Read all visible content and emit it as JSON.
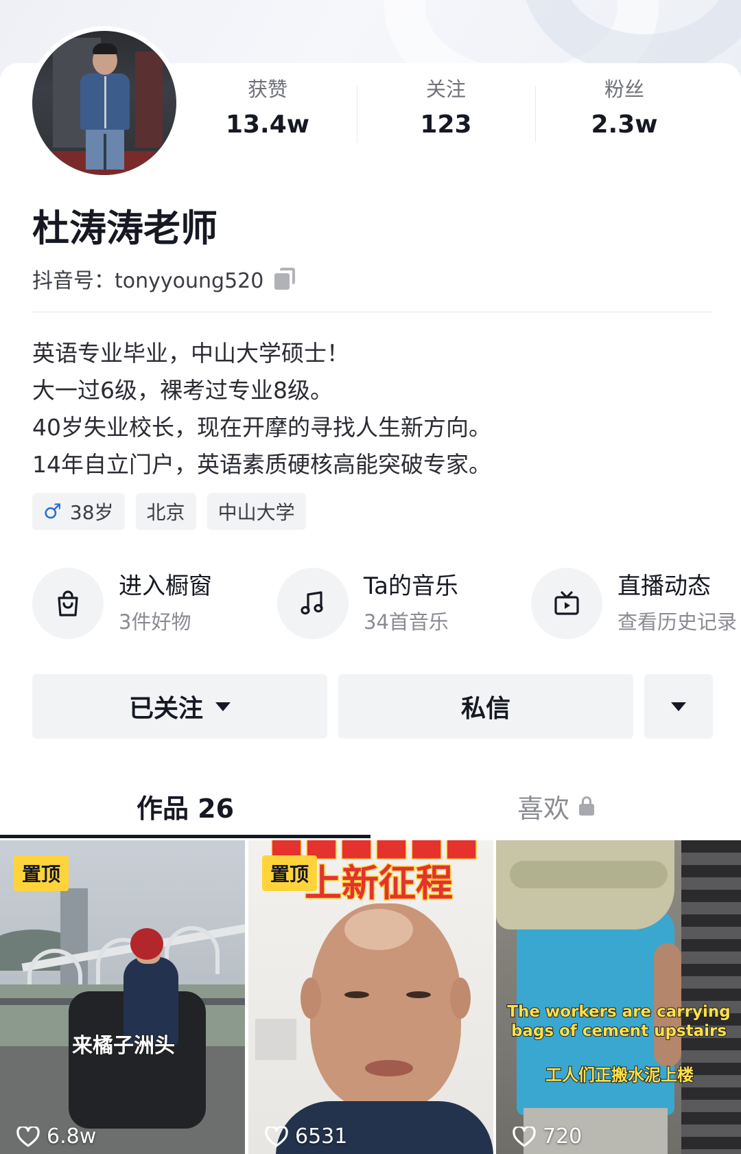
{
  "profile": {
    "name": "杜涛涛老师",
    "douyin_id": "抖音号：tonyyoung520",
    "stats": [
      {
        "label": "获赞",
        "value": "13.4w"
      },
      {
        "label": "关注",
        "value": "123"
      },
      {
        "label": "粉丝",
        "value": "2.3w"
      }
    ],
    "bio": [
      "英语专业毕业，中山大学硕士！",
      "大一过6级，裸考过专业8级。",
      "40岁失业校长，现在开摩的寻找人生新方向。",
      "14年自立门户，英语素质硬核高能突破专家。"
    ],
    "tags": [
      {
        "icon": "male-icon",
        "label": "38岁"
      },
      {
        "label": "北京"
      },
      {
        "label": "中山大学"
      }
    ]
  },
  "features": [
    {
      "icon": "shopping-bag-icon",
      "title": "进入橱窗",
      "subtitle": "3件好物"
    },
    {
      "icon": "music-note-icon",
      "title": "Ta的音乐",
      "subtitle": "34首音乐"
    },
    {
      "icon": "tv-play-icon",
      "title": "直播动态",
      "subtitle": "查看历史记录"
    }
  ],
  "actions": {
    "follow_label": "已关注",
    "message_label": "私信"
  },
  "tabs": [
    {
      "label": "作品 26",
      "active": true
    },
    {
      "label": "喜欢",
      "active": false,
      "locked": true
    }
  ],
  "videos": [
    {
      "pinned": true,
      "pin_label": "置顶",
      "caption": "来橘子洲头",
      "likes": "6.8w"
    },
    {
      "pinned": true,
      "pin_label": "置顶",
      "caption": "上新征程",
      "likes": "6531"
    },
    {
      "pinned": false,
      "caption_en": "The workers are carrying bags of cement upstairs",
      "caption_cn": "工人们正搬水泥上楼",
      "likes": "720"
    }
  ],
  "colors": {
    "accent_text": "#161823",
    "muted_text": "#8a8b92",
    "chip_bg": "#f2f3f5",
    "pin_badge": "#ffd43b",
    "male_blue": "#2b6fd8"
  }
}
